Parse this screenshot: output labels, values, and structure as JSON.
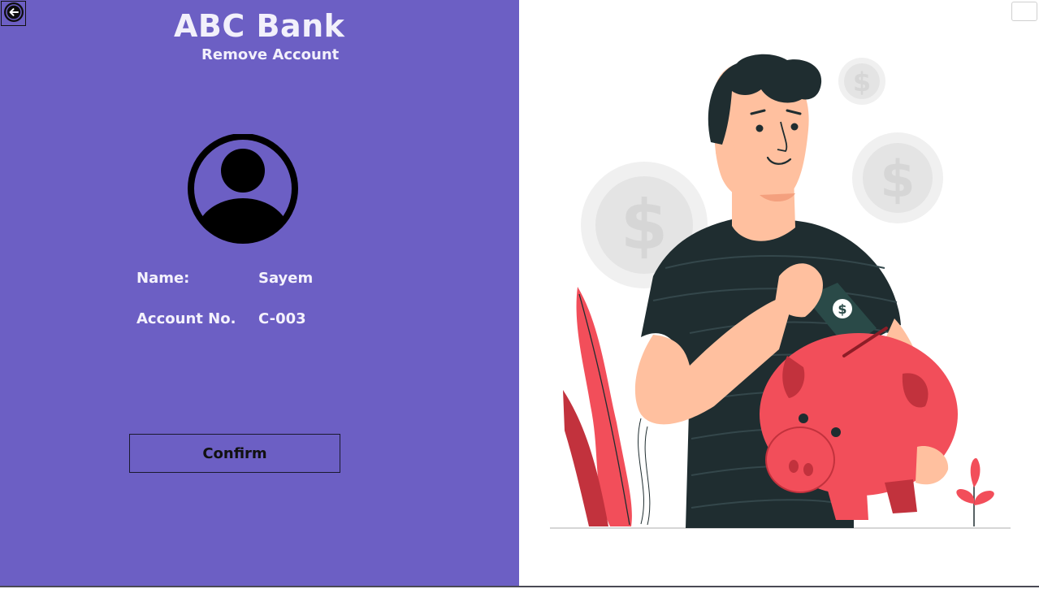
{
  "app": {
    "title": "ABC Bank",
    "subtitle": "Remove Account"
  },
  "account": {
    "name_label": "Name:",
    "name_value": "Sayem",
    "number_label": "Account No.",
    "number_value": "C-003"
  },
  "actions": {
    "confirm_label": "Confirm",
    "back_icon": "arrow-left-circle-icon"
  },
  "colors": {
    "panel": "#6c5fc4",
    "accent_red": "#f24e5a",
    "shirt": "#1f2d30"
  }
}
